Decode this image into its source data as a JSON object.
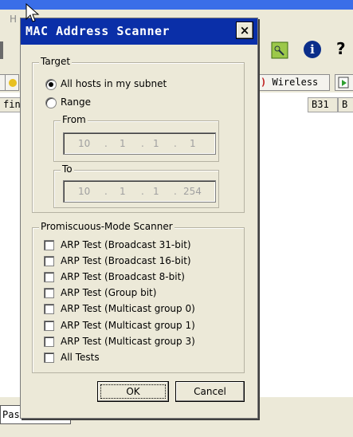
{
  "background_app": {
    "menu_help": "H",
    "tab_label": "Wireless",
    "column_headers": [
      "fin",
      "B31",
      "B"
    ],
    "status_text": "Pas"
  },
  "dialog": {
    "title": "MAC Address Scanner",
    "close_glyph": "×",
    "target": {
      "group_label": "Target",
      "options": [
        {
          "label": "All hosts in my subnet",
          "checked": true
        },
        {
          "label": "Range",
          "checked": false
        }
      ],
      "from": {
        "label": "From",
        "octets": [
          "10",
          "1",
          "1",
          "1"
        ]
      },
      "to": {
        "label": "To",
        "octets": [
          "10",
          "1",
          "1",
          "254"
        ]
      }
    },
    "promiscuous": {
      "group_label": "Promiscuous-Mode Scanner",
      "tests": [
        {
          "label": "ARP Test (Broadcast 31-bit)",
          "checked": false
        },
        {
          "label": "ARP Test (Broadcast 16-bit)",
          "checked": false
        },
        {
          "label": "ARP Test (Broadcast 8-bit)",
          "checked": false
        },
        {
          "label": "ARP Test (Group bit)",
          "checked": false
        },
        {
          "label": "ARP Test (Multicast group 0)",
          "checked": false
        },
        {
          "label": "ARP Test (Multicast group 1)",
          "checked": false
        },
        {
          "label": "ARP Test (Multicast group 3)",
          "checked": false
        },
        {
          "label": "All Tests",
          "checked": false
        }
      ]
    },
    "buttons": {
      "ok": "OK",
      "cancel": "Cancel"
    }
  },
  "colors": {
    "title_bar": "#0a2fa8",
    "dialog_bg": "#ece9d8",
    "disabled_text": "#a0a0a0"
  }
}
